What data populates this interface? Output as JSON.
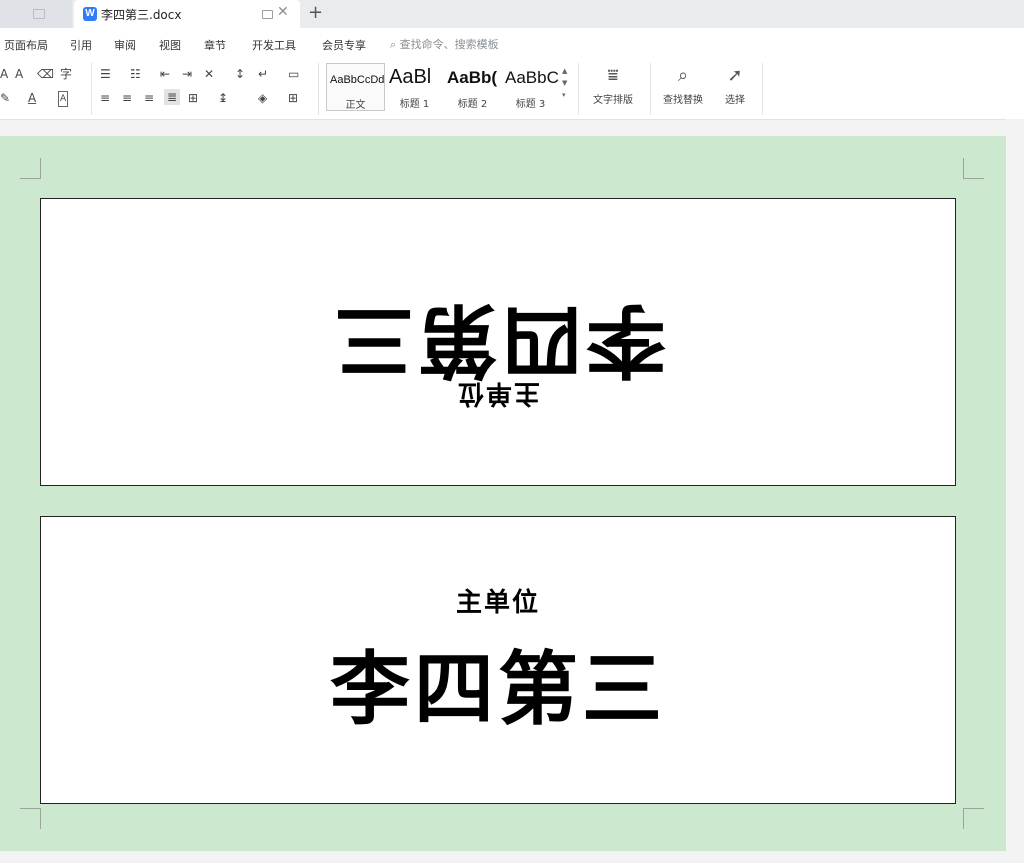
{
  "tabs": {
    "document_title": "李四第三.docx",
    "doc_icon_letter": "W",
    "close_glyph": "✕",
    "add_glyph": "+"
  },
  "menu": {
    "items": [
      "页面布局",
      "引用",
      "审阅",
      "视图",
      "章节",
      "开发工具",
      "会员专享"
    ],
    "search_placeholder": "查找命令、搜索模板",
    "search_icon": "search-icon"
  },
  "toolbar": {
    "styles": [
      {
        "sample": "AaBbCcDd",
        "label": "正文"
      },
      {
        "sample": "AaBl",
        "label": "标题 1"
      },
      {
        "sample": "AaBb(",
        "label": "标题 2"
      },
      {
        "sample": "AaBbC",
        "label": "标题 3"
      }
    ],
    "text_layout_label": "文字排版",
    "find_replace_label": "查找替换",
    "select_label": "选择"
  },
  "document": {
    "top_card": {
      "name": "李四第三",
      "org": "主单位"
    },
    "bottom_card": {
      "org": "主单位",
      "name": "李四第三"
    }
  },
  "colors": {
    "doc_background": "#cce8cf",
    "accent_blue": "#2f7df6"
  }
}
